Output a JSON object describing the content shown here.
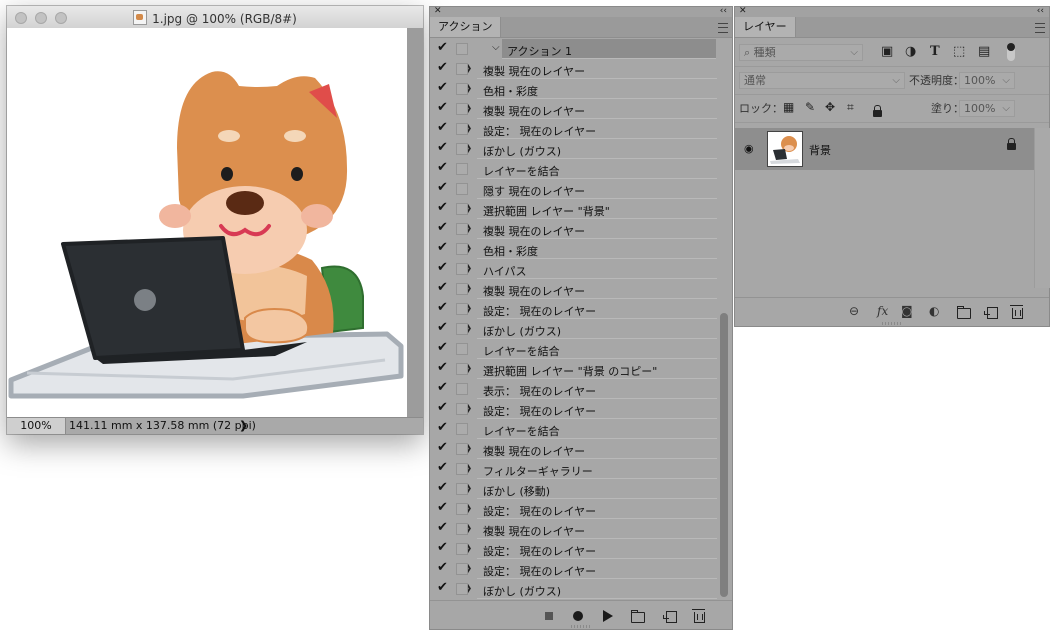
{
  "document": {
    "title": "1.jpg @ 100% (RGB/8#)",
    "zoom": "100%",
    "dimensions": "141.11 mm x 137.58 mm (72 ppi)",
    "status_arrow": "❯"
  },
  "actions_panel": {
    "tab": "アクション",
    "header": "アクション 1",
    "items": [
      {
        "label": "複製  現在のレイヤー",
        "expandable": true
      },
      {
        "label": "色相・彩度",
        "expandable": true
      },
      {
        "label": "複製  現在のレイヤー",
        "expandable": true
      },
      {
        "label": "設定：  現在のレイヤー",
        "expandable": true
      },
      {
        "label": "ぼかし (ガウス)",
        "expandable": true
      },
      {
        "label": "レイヤーを結合",
        "expandable": false
      },
      {
        "label": "隠す  現在のレイヤー",
        "expandable": false
      },
      {
        "label": "選択範囲  レイヤー \"背景\"",
        "expandable": true
      },
      {
        "label": "複製  現在のレイヤー",
        "expandable": true
      },
      {
        "label": "色相・彩度",
        "expandable": true
      },
      {
        "label": "ハイパス",
        "expandable": true
      },
      {
        "label": "複製  現在のレイヤー",
        "expandable": true
      },
      {
        "label": "設定：  現在のレイヤー",
        "expandable": true
      },
      {
        "label": "ぼかし (ガウス)",
        "expandable": true
      },
      {
        "label": "レイヤーを結合",
        "expandable": false
      },
      {
        "label": "選択範囲  レイヤー \"背景 のコピー\"",
        "expandable": true
      },
      {
        "label": "表示：  現在のレイヤー",
        "expandable": false
      },
      {
        "label": "設定：  現在のレイヤー",
        "expandable": true
      },
      {
        "label": "レイヤーを結合",
        "expandable": false
      },
      {
        "label": "複製  現在のレイヤー",
        "expandable": true
      },
      {
        "label": "フィルターギャラリー",
        "expandable": true
      },
      {
        "label": "ぼかし (移動)",
        "expandable": true
      },
      {
        "label": "設定：  現在のレイヤー",
        "expandable": true
      },
      {
        "label": "複製  現在のレイヤー",
        "expandable": true
      },
      {
        "label": "設定：  現在のレイヤー",
        "expandable": true
      },
      {
        "label": "設定：  現在のレイヤー",
        "expandable": true
      },
      {
        "label": "ぼかし (ガウス)",
        "expandable": true
      }
    ]
  },
  "layers_panel": {
    "tab": "レイヤー",
    "kind_placeholder": "種類",
    "blend_mode": "通常",
    "opacity_label": "不透明度：",
    "opacity_value": "100%",
    "lock_label": "ロック：",
    "fill_label": "塗り：",
    "fill_value": "100%",
    "layer_name": "背景",
    "footer_fx": "fx"
  },
  "colors": {
    "panel_bg": "#a7a7a7",
    "selected_row": "#8e8e8e",
    "shiba_orange": "#dc8f4e",
    "laptop": "#2b2f33"
  }
}
